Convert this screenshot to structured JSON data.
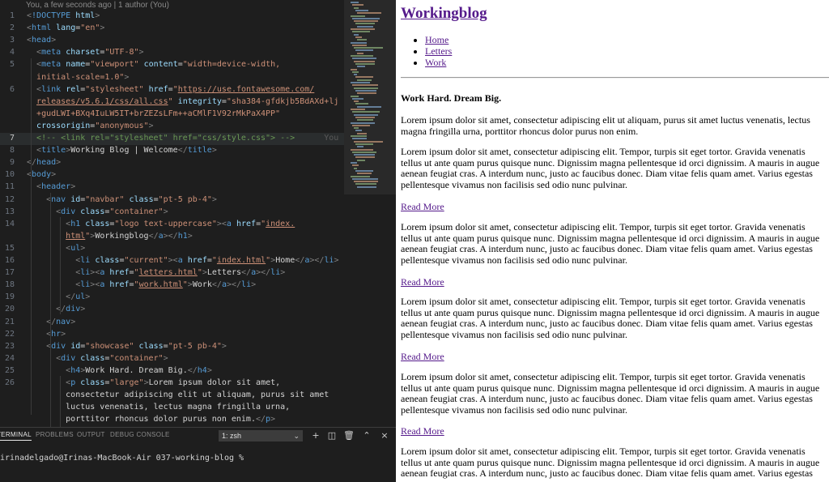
{
  "editor": {
    "blame_header": "You, a few seconds ago | 1 author (You)",
    "inline_blame": "You",
    "lines": [
      {
        "n": "1",
        "html": "<span class='tp'>&lt;</span><span class='kw'>!DOCTYPE</span> <span class='a'>html</span><span class='tp'>&gt;</span>"
      },
      {
        "n": "2",
        "html": "<span class='tp'>&lt;</span><span class='t'>html</span> <span class='a'>lang</span>=<span class='s'>\"en\"</span><span class='tp'>&gt;</span>"
      },
      {
        "n": "3",
        "html": "<span class='tp'>&lt;</span><span class='t'>head</span><span class='tp'>&gt;</span>"
      },
      {
        "n": "4",
        "html": "  <span class='tp'>&lt;</span><span class='t'>meta</span> <span class='a'>charset</span>=<span class='s'>\"UTF-8\"</span><span class='tp'>&gt;</span>"
      },
      {
        "n": "5",
        "html": "  <span class='tp'>&lt;</span><span class='t'>meta</span> <span class='a'>name</span>=<span class='s'>\"viewport\"</span> <span class='a'>content</span>=<span class='s'>\"width=device-width,</span>"
      },
      {
        "n": "",
        "html": "  <span class='s'>initial-scale=1.0\"</span><span class='tp'>&gt;</span>"
      },
      {
        "n": "6",
        "html": "  <span class='tp'>&lt;</span><span class='t'>link</span> <span class='a'>rel</span>=<span class='s'>\"stylesheet\"</span> <span class='a'>href</span>=<span class='s'>\"</span><span class='u'>https://use.fontawesome.com/</span>"
      },
      {
        "n": "",
        "html": "  <span class='u'>releases/v5.6.1/css/all.css</span><span class='s'>\"</span> <span class='a'>integrity</span>=<span class='s'>\"sha384-gfdkjb5BdAXd+lj</span>"
      },
      {
        "n": "",
        "html": "  <span class='s'>+gudLWI+BXq4IuLW5IT+brZEZsLFm++aCMlF1V92rMkPaX4PP\"</span>"
      },
      {
        "n": "",
        "html": "  <span class='a'>crossorigin</span>=<span class='s'>\"anonymous\"</span><span class='tp'>&gt;</span>"
      },
      {
        "n": "7",
        "html": "  <span class='c'>&lt;!-- &lt;link rel=\"stylesheet\" href=\"css/style.css\"&gt; --&gt;</span>"
      },
      {
        "n": "8",
        "html": "  <span class='tp'>&lt;</span><span class='t'>title</span><span class='tp'>&gt;</span>Working Blog | Welcome<span class='tp'>&lt;/</span><span class='t'>title</span><span class='tp'>&gt;</span>"
      },
      {
        "n": "9",
        "html": "<span class='tp'>&lt;/</span><span class='t'>head</span><span class='tp'>&gt;</span>"
      },
      {
        "n": "10",
        "html": "<span class='tp'>&lt;</span><span class='t'>body</span><span class='tp'>&gt;</span>"
      },
      {
        "n": "11",
        "html": "  <span class='tp'>&lt;</span><span class='t'>header</span><span class='tp'>&gt;</span>"
      },
      {
        "n": "12",
        "html": "    <span class='tp'>&lt;</span><span class='t'>nav</span> <span class='a'>id</span>=<span class='s'>\"navbar\"</span> <span class='a'>class</span>=<span class='s'>\"pt-5 pb-4\"</span><span class='tp'>&gt;</span>"
      },
      {
        "n": "13",
        "html": "      <span class='tp'>&lt;</span><span class='t'>div</span> <span class='a'>class</span>=<span class='s'>\"container\"</span><span class='tp'>&gt;</span>"
      },
      {
        "n": "14",
        "html": "        <span class='tp'>&lt;</span><span class='t'>h1</span> <span class='a'>class</span>=<span class='s'>\"logo text-uppercase\"</span><span class='tp'>&gt;&lt;</span><span class='t'>a</span> <span class='a'>href</span>=<span class='s'>\"</span><span class='u'>index.</span>"
      },
      {
        "n": "",
        "html": "        <span class='u'>html</span><span class='s'>\"</span><span class='tp'>&gt;</span>Workingblog<span class='tp'>&lt;/</span><span class='t'>a</span><span class='tp'>&gt;&lt;/</span><span class='t'>h1</span><span class='tp'>&gt;</span>"
      },
      {
        "n": "15",
        "html": "        <span class='tp'>&lt;</span><span class='t'>ul</span><span class='tp'>&gt;</span>"
      },
      {
        "n": "16",
        "html": "          <span class='tp'>&lt;</span><span class='t'>li</span> <span class='a'>class</span>=<span class='s'>\"current\"</span><span class='tp'>&gt;&lt;</span><span class='t'>a</span> <span class='a'>href</span>=<span class='s'>\"</span><span class='u'>index.html</span><span class='s'>\"</span><span class='tp'>&gt;</span>Home<span class='tp'>&lt;/</span><span class='t'>a</span><span class='tp'>&gt;&lt;/</span><span class='t'>li</span><span class='tp'>&gt;</span>"
      },
      {
        "n": "17",
        "html": "          <span class='tp'>&lt;</span><span class='t'>li</span><span class='tp'>&gt;&lt;</span><span class='t'>a</span> <span class='a'>href</span>=<span class='s'>\"</span><span class='u'>letters.html</span><span class='s'>\"</span><span class='tp'>&gt;</span>Letters<span class='tp'>&lt;/</span><span class='t'>a</span><span class='tp'>&gt;&lt;/</span><span class='t'>li</span><span class='tp'>&gt;</span>"
      },
      {
        "n": "18",
        "html": "          <span class='tp'>&lt;</span><span class='t'>li</span><span class='tp'>&gt;&lt;</span><span class='t'>a</span> <span class='a'>href</span>=<span class='s'>\"</span><span class='u'>work.html</span><span class='s'>\"</span><span class='tp'>&gt;</span>Work<span class='tp'>&lt;/</span><span class='t'>a</span><span class='tp'>&gt;&lt;/</span><span class='t'>li</span><span class='tp'>&gt;</span>"
      },
      {
        "n": "19",
        "html": "        <span class='tp'>&lt;/</span><span class='t'>ul</span><span class='tp'>&gt;</span>"
      },
      {
        "n": "20",
        "html": "      <span class='tp'>&lt;/</span><span class='t'>div</span><span class='tp'>&gt;</span>"
      },
      {
        "n": "21",
        "html": "    <span class='tp'>&lt;/</span><span class='t'>nav</span><span class='tp'>&gt;</span>"
      },
      {
        "n": "22",
        "html": "    <span class='tp'>&lt;</span><span class='t'>hr</span><span class='tp'>&gt;</span>"
      },
      {
        "n": "23",
        "html": "    <span class='tp'>&lt;</span><span class='t'>div</span> <span class='a'>id</span>=<span class='s'>\"showcase\"</span> <span class='a'>class</span>=<span class='s'>\"pt-5 pb-4\"</span><span class='tp'>&gt;</span>"
      },
      {
        "n": "24",
        "html": "      <span class='tp'>&lt;</span><span class='t'>div</span> <span class='a'>class</span>=<span class='s'>\"container\"</span><span class='tp'>&gt;</span>"
      },
      {
        "n": "25",
        "html": "        <span class='tp'>&lt;</span><span class='t'>h4</span><span class='tp'>&gt;</span>Work Hard. Dream Big.<span class='tp'>&lt;/</span><span class='t'>h4</span><span class='tp'>&gt;</span>"
      },
      {
        "n": "26",
        "html": "        <span class='tp'>&lt;</span><span class='t'>p</span> <span class='a'>class</span>=<span class='s'>\"large\"</span><span class='tp'>&gt;</span>Lorem ipsum dolor sit amet,"
      },
      {
        "n": "",
        "html": "        consectetur adipiscing elit ut aliquam, purus sit amet"
      },
      {
        "n": "",
        "html": "        luctus venenatis, lectus magna fringilla urna,"
      },
      {
        "n": "",
        "html": "        porttitor rhoncus dolor purus non enim.<span class='tp'>&lt;/</span><span class='t'>p</span><span class='tp'>&gt;</span>"
      }
    ]
  },
  "terminal": {
    "tabs": [
      "TERMINAL",
      "PROBLEMS",
      "OUTPUT",
      "DEBUG CONSOLE"
    ],
    "shell_select": "1: zsh",
    "prompt": "irinadelgado@Irinas-MacBook-Air 037-working-blog %"
  },
  "site": {
    "title": "Workingblog",
    "nav": [
      "Home",
      "Letters",
      "Work"
    ],
    "tagline": "Work Hard. Dream Big.",
    "intro": "Lorem ipsum dolor sit amet, consectetur adipiscing elit ut aliquam, purus sit amet luctus venenatis, lectus magna fringilla urna, porttitor rhoncus dolor purus non enim.",
    "post_text": "Lorem ipsum dolor sit amet, consectetur adipiscing elit. Tempor, turpis sit eget tortor. Gravida venenatis tellus ut ante quam purus quisque nunc. Dignissim magna pellentesque id orci dignissim. A mauris in augue aenean feugiat cras. A interdum nunc, justo ac faucibus donec. Diam vitae felis quam amet. Varius egestas pellentesque vivamus non facilisis sed odio nunc pulvinar.",
    "read_more": "Read More",
    "posts": [
      {
        "text": "Lorem ipsum dolor sit amet, consectetur adipiscing elit. Tempor, turpis sit eget tortor. Gravida venenatis tellus ut ante quam purus quisque nunc. Dignissim magna pellentesque id orci dignissim. A mauris in augue aenean feugiat cras. A interdum nunc, justo ac faucibus donec. Diam vitae felis quam amet. Varius egestas pellentesque vivamus non facilisis sed odio nunc pulvinar.",
        "link": "Read More"
      },
      {
        "text": "Lorem ipsum dolor sit amet, consectetur adipiscing elit. Tempor, turpis sit eget tortor. Gravida venenatis tellus ut ante quam purus quisque nunc. Dignissim magna pellentesque id orci dignissim. A mauris in augue aenean feugiat cras. A interdum nunc, justo ac faucibus donec. Diam vitae felis quam amet. Varius egestas pellentesque vivamus non facilisis sed odio nunc pulvinar.",
        "link": "Read More"
      },
      {
        "text": "Lorem ipsum dolor sit amet, consectetur adipiscing elit. Tempor, turpis sit eget tortor. Gravida venenatis tellus ut ante quam purus quisque nunc. Dignissim magna pellentesque id orci dignissim. A mauris in augue aenean feugiat cras. A interdum nunc, justo ac faucibus donec. Diam vitae felis quam amet. Varius egestas pellentesque vivamus non facilisis sed odio nunc pulvinar.",
        "link": "Read More"
      },
      {
        "text": "Lorem ipsum dolor sit amet, consectetur adipiscing elit. Tempor, turpis sit eget tortor. Gravida venenatis tellus ut ante quam purus quisque nunc. Dignissim magna pellentesque id orci dignissim. A mauris in augue aenean feugiat cras. A interdum nunc, justo ac faucibus donec. Diam vitae felis quam amet. Varius egestas pellentesque vivamus non facilisis sed odio nunc pulvinar.",
        "link": "Read More"
      },
      {
        "text": "Lorem ipsum dolor sit amet, consectetur adipiscing elit. Tempor, turpis sit eget tortor. Gravida venenatis tellus ut ante quam purus quisque nunc. Dignissim magna pellentesque id orci dignissim. A mauris in augue aenean feugiat cras. A interdum nunc, justo ac faucibus donec. Diam vitae felis quam amet. Varius egestas pellentesque vivamus non facilisis sed odio nunc pulvinar.",
        "link": ""
      }
    ]
  },
  "colors": {
    "editor_bg": "#1e1e1e",
    "link_visited": "#551a8b"
  }
}
